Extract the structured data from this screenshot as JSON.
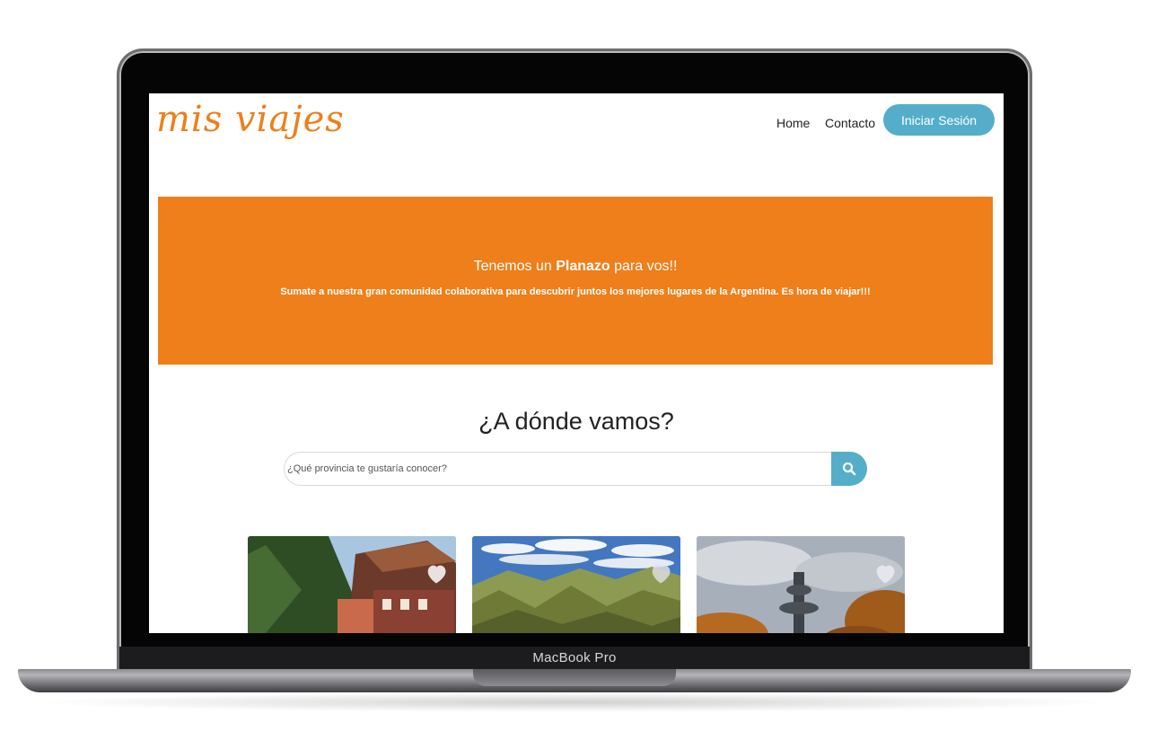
{
  "device": {
    "label": "MacBook Pro"
  },
  "site": {
    "logo": "mis viajes",
    "nav": {
      "home": "Home",
      "contacto": "Contacto"
    },
    "login_button": "Iniciar Sesión"
  },
  "hero": {
    "title_pre": "Tenemos un ",
    "title_bold": "Planazo",
    "title_post": " para vos!!",
    "text": "Sumate a nuestra gran comunidad colaborativa para descubrir juntos los mejores lugares de la Argentina. Es hora de viajar!!!"
  },
  "search": {
    "title": "¿A dónde vamos?",
    "placeholder": "¿Qué provincia te gustaría conocer?",
    "button_icon": "search-icon"
  },
  "cards": [
    {
      "icon": "heart-icon"
    },
    {
      "icon": "heart-icon"
    },
    {
      "icon": "heart-icon"
    }
  ],
  "colors": {
    "brand_orange": "#ee7f1a",
    "accent_blue": "#55aec9"
  }
}
